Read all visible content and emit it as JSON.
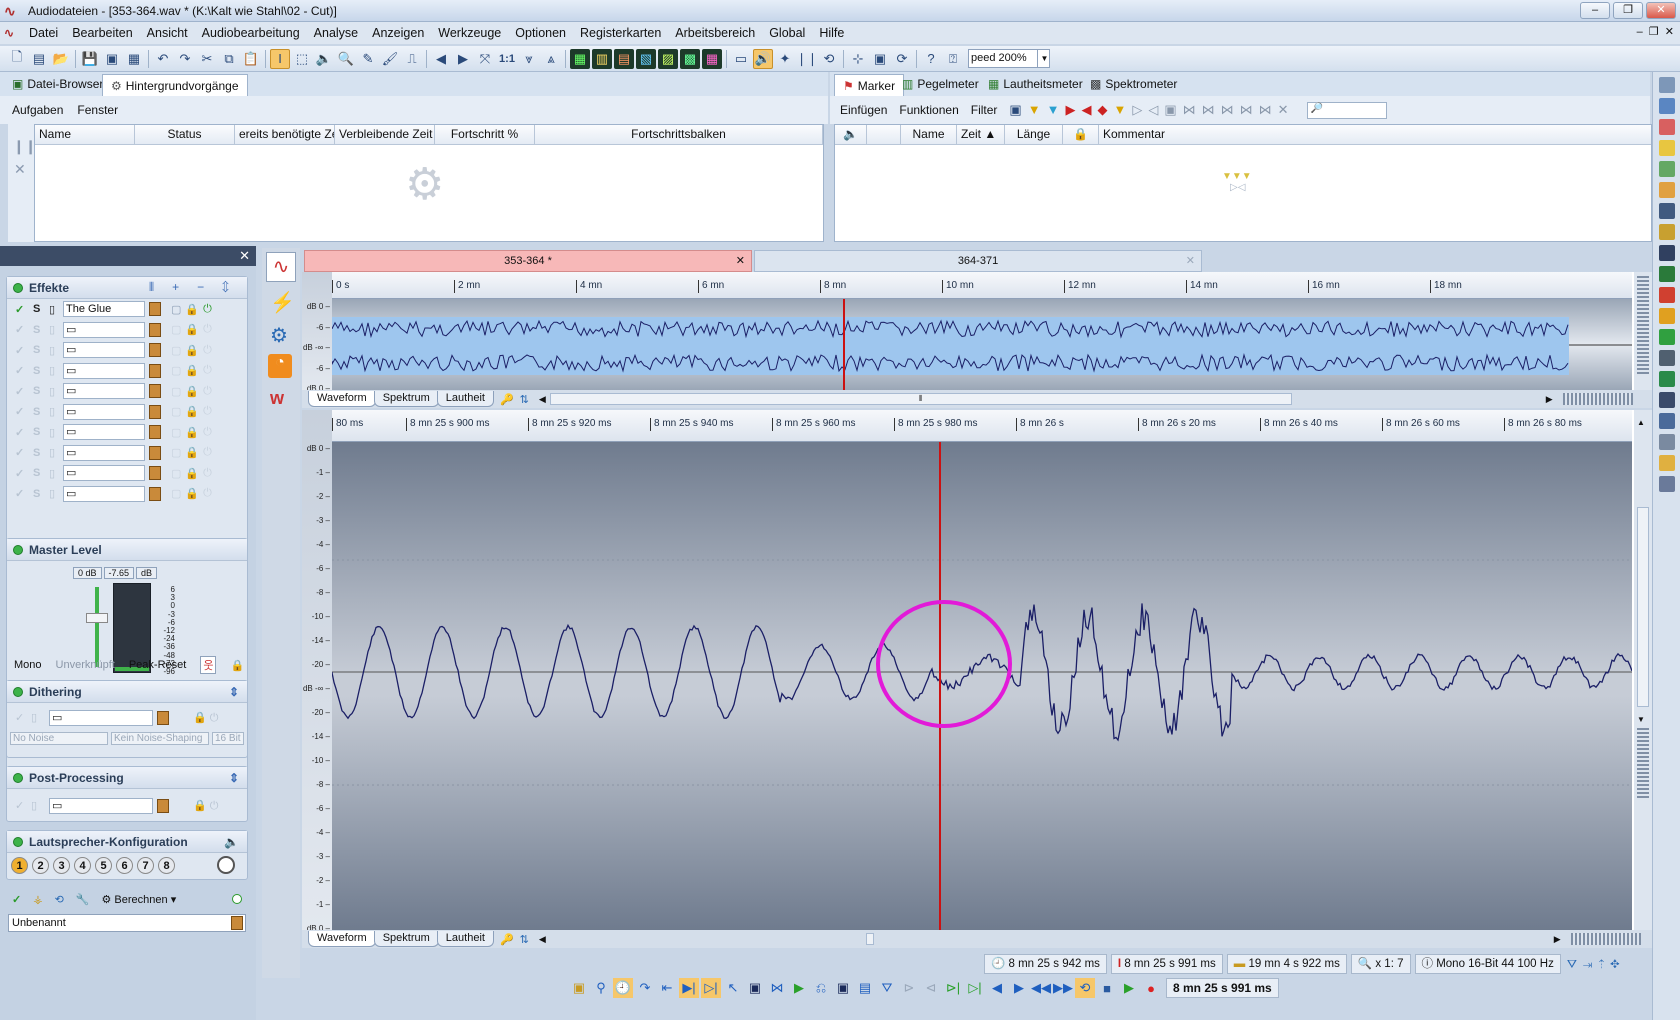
{
  "window": {
    "title": "Audiodateien - [353-364.wav * (K:\\Kalt wie Stahl\\02 - Cut)]",
    "buttons": [
      "–",
      "❐",
      "✕"
    ]
  },
  "menu": [
    "Datei",
    "Bearbeiten",
    "Ansicht",
    "Audiobearbeitung",
    "Analyse",
    "Anzeigen",
    "Werkzeuge",
    "Optionen",
    "Registerkarten",
    "Arbeitsbereich",
    "Global",
    "Hilfe"
  ],
  "toolbar": {
    "speed_value": "peed 200%"
  },
  "left_panel": {
    "tabs": [
      "Datei-Browser",
      "Hintergrundvorgänge"
    ],
    "submenu": [
      "Aufgaben",
      "Fenster"
    ],
    "columns": [
      "Name",
      "Status",
      "ereits benötigte Ze",
      "Verbleibende Zeit",
      "Fortschritt %",
      "Fortschrittsbalken"
    ]
  },
  "right_panel": {
    "tabs": [
      "Marker",
      "Pegelmeter",
      "Lautheitsmeter",
      "Spektrometer"
    ],
    "submenu": [
      "Einfügen",
      "Funktionen",
      "Filter"
    ],
    "columns": [
      "Name",
      "Zeit",
      "Länge",
      "Kommentar"
    ]
  },
  "effects": {
    "title": "Effekte",
    "first_plugin": "The Glue",
    "solo": "S",
    "master_title": "Master Level",
    "master_readouts": [
      "0 dB",
      "-7.65",
      "dB"
    ],
    "meter_scale": [
      "6",
      "3",
      "0",
      "-3",
      "-6",
      "-12",
      "-24",
      "-36",
      "-48",
      "-72",
      "-96"
    ],
    "mono": "Mono",
    "unlinked": "Unverknüpft",
    "peak_reset": "Peak-Reset",
    "dithering_title": "Dithering",
    "dither_opts": [
      "No Noise",
      "Kein Noise-Shaping",
      "16 Bit"
    ],
    "post_title": "Post-Processing",
    "speaker_title": "Lautsprecher-Konfiguration",
    "speakers": [
      "1",
      "2",
      "3",
      "4",
      "5",
      "6",
      "7",
      "8"
    ],
    "compute": "Berechnen",
    "preset": "Unbenannt"
  },
  "doc_tabs": [
    "353-364 *",
    "364-371"
  ],
  "overview": {
    "ruler": [
      "0 s",
      "2 mn",
      "4 mn",
      "6 mn",
      "8 mn",
      "10 mn",
      "12 mn",
      "14 mn",
      "16 mn",
      "18 mn"
    ],
    "db": [
      "dB 0",
      "-6",
      "dB -∞",
      "-6",
      "dB 0"
    ]
  },
  "detail": {
    "ruler": [
      "80 ms",
      "8 mn 25 s 900 ms",
      "8 mn 25 s 920 ms",
      "8 mn 25 s 940 ms",
      "8 mn 25 s 960 ms",
      "8 mn 25 s 980 ms",
      "8 mn 26 s",
      "8 mn 26 s 20 ms",
      "8 mn 26 s 40 ms",
      "8 mn 26 s 60 ms",
      "8 mn 26 s 80 ms"
    ],
    "db": [
      "dB 0",
      "-1",
      "-2",
      "-3",
      "-4",
      "-6",
      "-8",
      "-10",
      "-14",
      "-20",
      "dB -∞",
      "-20",
      "-14",
      "-10",
      "-8",
      "-6",
      "-4",
      "-3",
      "-2",
      "-1",
      "dB 0"
    ]
  },
  "view_tabs": [
    "Waveform",
    "Spektrum",
    "Lautheit"
  ],
  "status": {
    "pos1": "8 mn 25 s 942 ms",
    "pos2": "8 mn 25 s 991 ms",
    "length": "19 mn 4 s 922 ms",
    "zoom": "x 1: 7",
    "format": "Mono 16-Bit 44 100 Hz"
  },
  "transport": {
    "time": "8 mn 25 s 991 ms"
  },
  "colors": {
    "wave": "#1b1f66",
    "cursor": "#cc1111",
    "circle": "#e21ad8",
    "active_tab": "#f7b8b8"
  }
}
